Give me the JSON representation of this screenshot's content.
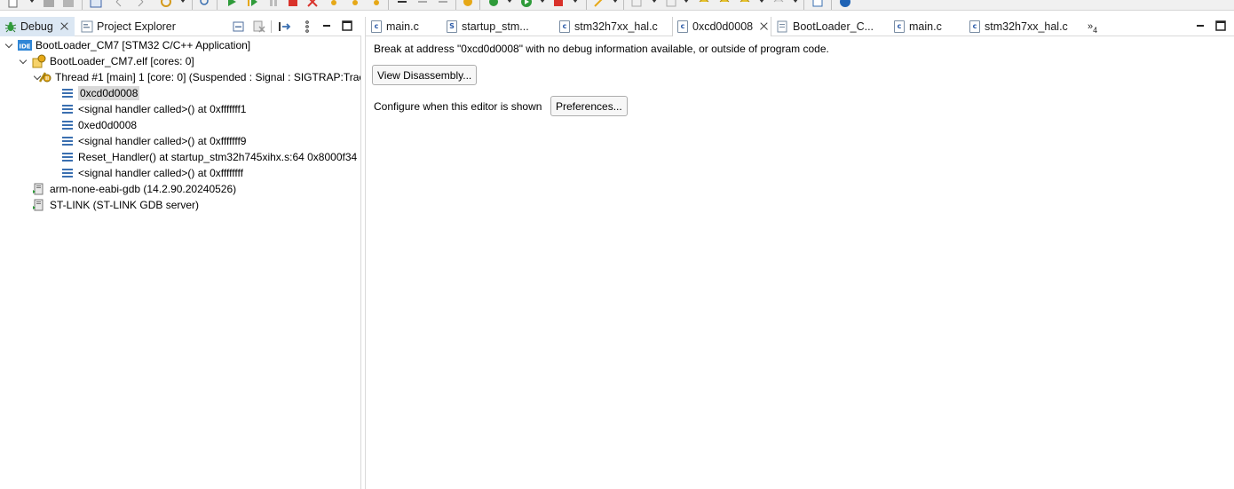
{
  "debug_view": {
    "tabs": [
      {
        "label": "Debug",
        "active": true,
        "closable": true
      },
      {
        "label": "Project Explorer",
        "active": false,
        "closable": false
      }
    ],
    "tree": {
      "launch": {
        "label": "BootLoader_CM7 [STM32 C/C++ Application]"
      },
      "process": {
        "label": "BootLoader_CM7.elf [cores: 0]"
      },
      "thread": {
        "label": "Thread #1 [main] 1 [core: 0] (Suspended : Signal : SIGTRAP:Trac"
      },
      "frames": [
        {
          "label": "0xcd0d0008",
          "selected": true
        },
        {
          "label": "<signal handler called>() at 0xfffffff1",
          "selected": false
        },
        {
          "label": "0xed0d0008",
          "selected": false
        },
        {
          "label": "<signal handler called>() at 0xfffffff9",
          "selected": false
        },
        {
          "label": "Reset_Handler() at startup_stm32h745xihx.s:64 0x8000f34",
          "selected": false
        },
        {
          "label": "<signal handler called>() at 0xffffffff",
          "selected": false
        }
      ],
      "debugger": {
        "label": "arm-none-eabi-gdb (14.2.90.20240526)"
      },
      "server": {
        "label": "ST-LINK (ST-LINK GDB server)"
      }
    }
  },
  "editor": {
    "tabs": [
      {
        "label": "main.c",
        "icon": "c-file-icon",
        "active": false
      },
      {
        "label": "startup_stm...",
        "icon": "s-file-icon",
        "active": false
      },
      {
        "label": "stm32h7xx_hal.c",
        "icon": "c-file-icon",
        "active": false
      },
      {
        "label": "0xcd0d0008",
        "icon": "c-file-icon",
        "active": true
      },
      {
        "label": "BootLoader_C...",
        "icon": "document-icon",
        "active": false
      },
      {
        "label": "main.c",
        "icon": "c-file-icon",
        "active": false
      },
      {
        "label": "stm32h7xx_hal.c",
        "icon": "c-file-icon",
        "active": false
      }
    ],
    "overflow": {
      "symbol": "»",
      "count": "4"
    },
    "message": "Break at address \"0xcd0d0008\" with no debug information available, or outside of program code.",
    "view_disassembly_label": "View Disassembly...",
    "configure_label": "Configure when this editor is shown",
    "preferences_label": "Preferences..."
  },
  "colors": {
    "active_view_tab": "#dbe7f3",
    "selection": "#d9d9d9",
    "border": "#d9d9d9"
  }
}
